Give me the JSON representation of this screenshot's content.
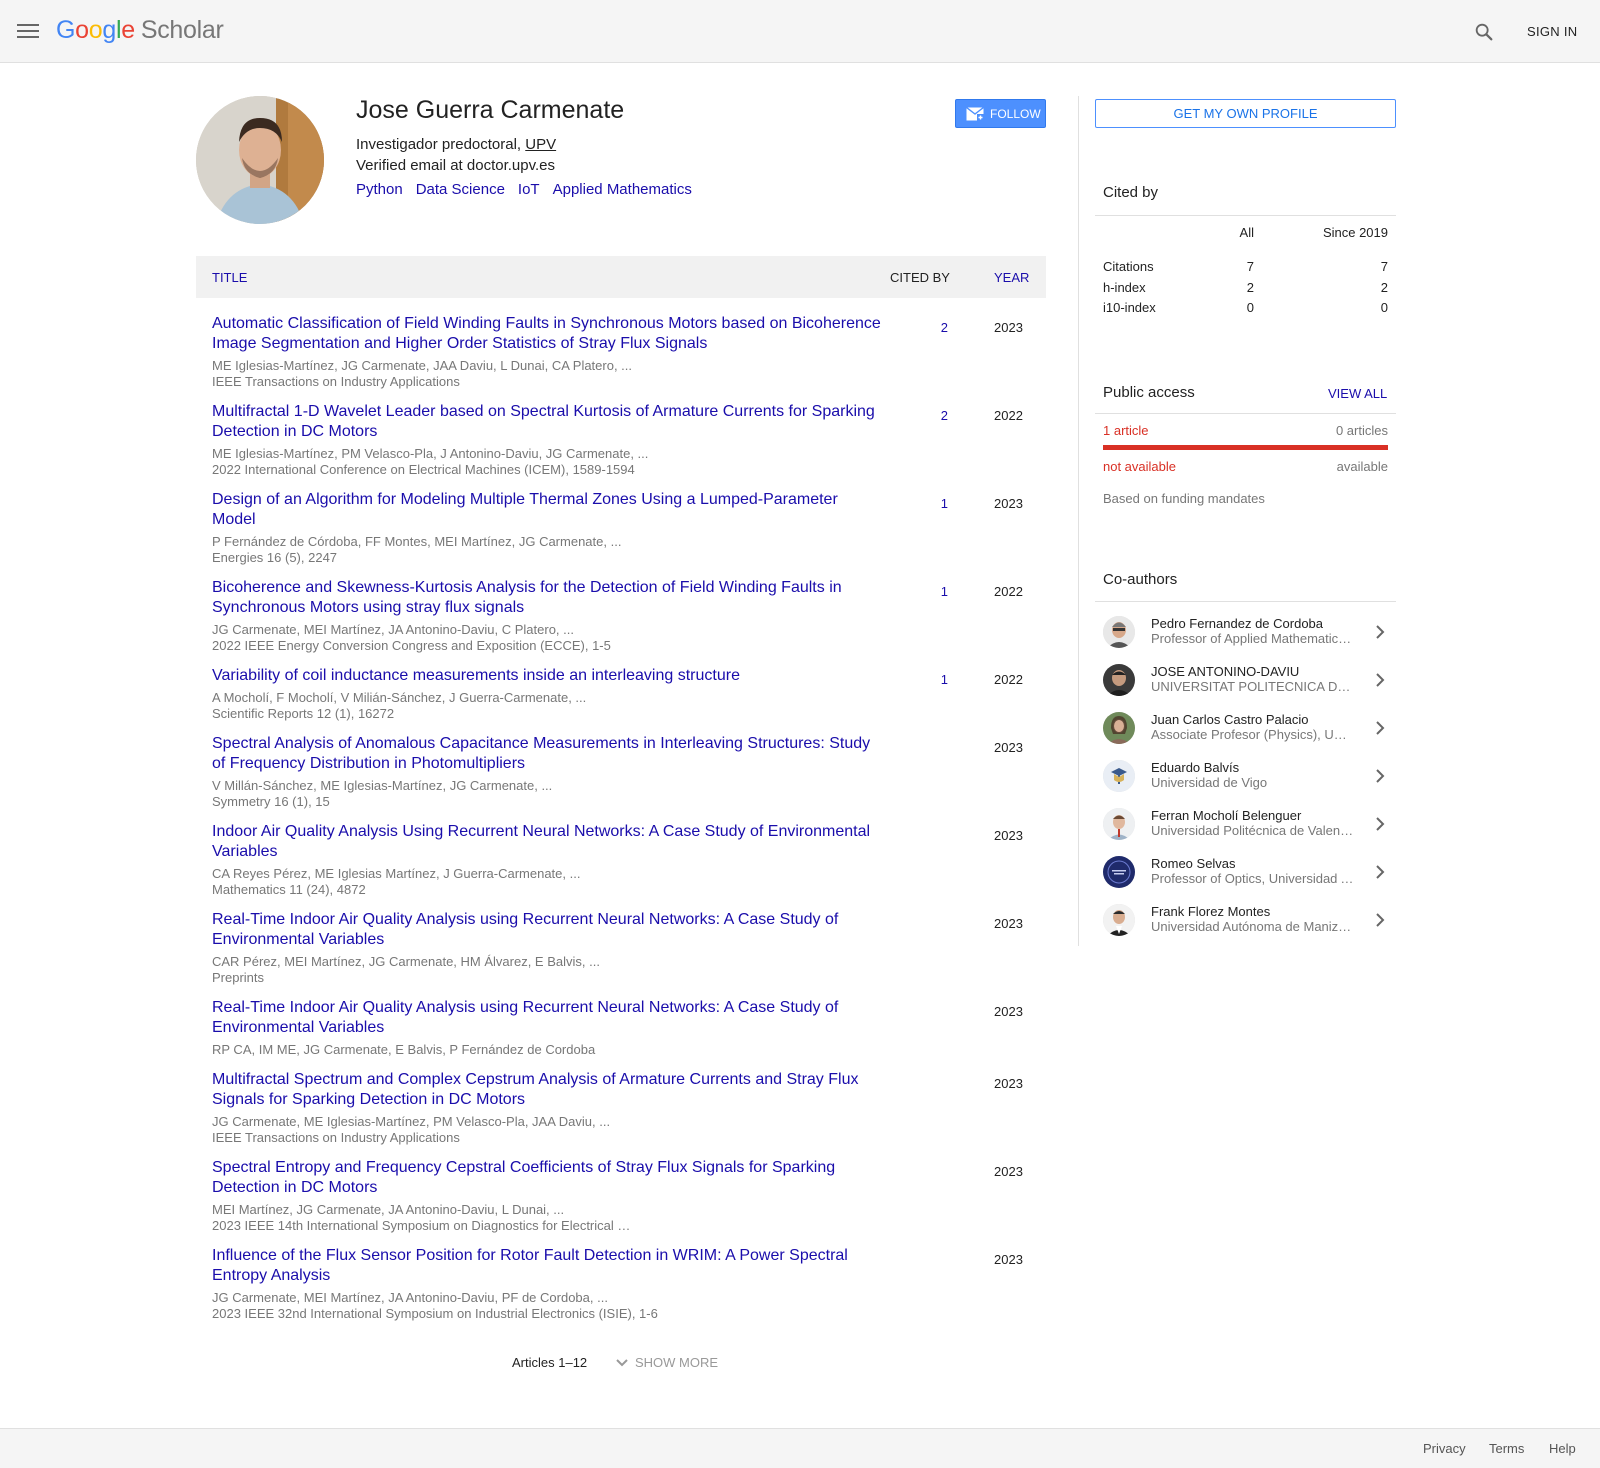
{
  "header": {
    "logo_google": [
      "G",
      "o",
      "o",
      "g",
      "l",
      "e"
    ],
    "logo_scholar": "Scholar",
    "signin_label": "SIGN IN"
  },
  "profile": {
    "name": "Jose Guerra Carmenate",
    "affiliation_prefix": "Investigador predoctoral, ",
    "affiliation_org": "UPV",
    "email": "Verified email at doctor.upv.es",
    "interests": [
      "Python",
      "Data Science",
      "IoT",
      "Applied Mathematics"
    ],
    "follow_label": "FOLLOW"
  },
  "table": {
    "col_title": "TITLE",
    "col_cited": "CITED BY",
    "col_year": "YEAR"
  },
  "articles": [
    {
      "title": "Automatic Classification of Field Winding Faults in Synchronous Motors based on Bicoherence Image Segmentation and Higher Order Statistics of Stray Flux Signals",
      "authors": "ME Iglesias-Martínez, JG Carmenate, JAA Daviu, L Dunai, CA Platero, ...",
      "venue": "IEEE Transactions on Industry Applications",
      "cited": "2",
      "year": "2023"
    },
    {
      "title": "Multifractal 1-D Wavelet Leader based on Spectral Kurtosis of Armature Currents for Sparking Detection in DC Motors",
      "authors": "ME Iglesias-Martínez, PM Velasco-Pla, J Antonino-Daviu, JG Carmenate, ...",
      "venue": "2022 International Conference on Electrical Machines (ICEM), 1589-1594",
      "cited": "2",
      "year": "2022"
    },
    {
      "title": "Design of an Algorithm for Modeling Multiple Thermal Zones Using a Lumped-Parameter Model",
      "authors": "P Fernández de Córdoba, FF Montes, MEI Martínez, JG Carmenate, ...",
      "venue": "Energies 16 (5), 2247",
      "cited": "1",
      "year": "2023"
    },
    {
      "title": "Bicoherence and Skewness-Kurtosis Analysis for the Detection of Field Winding Faults in Synchronous Motors using stray flux signals",
      "authors": "JG Carmenate, MEI Martínez, JA Antonino-Daviu, C Platero, ...",
      "venue": "2022 IEEE Energy Conversion Congress and Exposition (ECCE), 1-5",
      "cited": "1",
      "year": "2022"
    },
    {
      "title": "Variability of coil inductance measurements inside an interleaving structure",
      "authors": "A Mocholí, F Mocholí, V Milián-Sánchez, J Guerra-Carmenate, ...",
      "venue": "Scientific Reports 12 (1), 16272",
      "cited": "1",
      "year": "2022"
    },
    {
      "title": "Spectral Analysis of Anomalous Capacitance Measurements in Interleaving Structures: Study of Frequency Distribution in Photomultipliers",
      "authors": "V Millán-Sánchez, ME Iglesias-Martínez, JG Carmenate, ...",
      "venue": "Symmetry 16 (1), 15",
      "cited": "",
      "year": "2023"
    },
    {
      "title": "Indoor Air Quality Analysis Using Recurrent Neural Networks: A Case Study of Environmental Variables",
      "authors": "CA Reyes Pérez, ME Iglesias Martínez, J Guerra-Carmenate, ...",
      "venue": "Mathematics 11 (24), 4872",
      "cited": "",
      "year": "2023"
    },
    {
      "title": "Real-Time Indoor Air Quality Analysis using Recurrent Neural Networks: A Case Study of Environmental Variables",
      "authors": "CAR Pérez, MEI Martínez, JG Carmenate, HM Álvarez, E Balvis, ...",
      "venue": "Preprints",
      "cited": "",
      "year": "2023"
    },
    {
      "title": "Real-Time Indoor Air Quality Analysis using Recurrent Neural Networks: A Case Study of Environmental Variables",
      "authors": "RP CA, IM ME, JG Carmenate, E Balvis, P Fernández de Cordoba",
      "venue": "",
      "cited": "",
      "year": "2023"
    },
    {
      "title": "Multifractal Spectrum and Complex Cepstrum Analysis of Armature Currents and Stray Flux Signals for Sparking Detection in DC Motors",
      "authors": "JG Carmenate, ME Iglesias-Martínez, PM Velasco-Pla, JAA Daviu, ...",
      "venue": "IEEE Transactions on Industry Applications",
      "cited": "",
      "year": "2023"
    },
    {
      "title": "Spectral Entropy and Frequency Cepstral Coefficients of Stray Flux Signals for Sparking Detection in DC Motors",
      "authors": "MEI Martínez, JG Carmenate, JA Antonino-Daviu, L Dunai, ...",
      "venue": "2023 IEEE 14th International Symposium on Diagnostics for Electrical …",
      "cited": "",
      "year": "2023"
    },
    {
      "title": "Influence of the Flux Sensor Position for Rotor Fault Detection in WRIM: A Power Spectral Entropy Analysis",
      "authors": "JG Carmenate, MEI Martínez, JA Antonino-Daviu, PF de Cordoba, ...",
      "venue": "2023 IEEE 32nd International Symposium on Industrial Electronics (ISIE), 1-6",
      "cited": "",
      "year": "2023"
    }
  ],
  "pager": {
    "range": "Articles 1–12",
    "show_more": "SHOW MORE"
  },
  "sidebar": {
    "get_profile": "GET MY OWN PROFILE",
    "cited_by": {
      "title": "Cited by",
      "col_all": "All",
      "col_since": "Since 2019",
      "rows": [
        {
          "label": "Citations",
          "all": "7",
          "since": "7"
        },
        {
          "label": "h-index",
          "all": "2",
          "since": "2"
        },
        {
          "label": "i10-index",
          "all": "0",
          "since": "0"
        }
      ]
    },
    "public_access": {
      "title": "Public access",
      "view_all": "VIEW ALL",
      "left_count": "1 article",
      "right_count": "0 articles",
      "left_status": "not available",
      "right_status": "available",
      "note": "Based on funding mandates"
    },
    "coauthors": {
      "title": "Co-authors",
      "items": [
        {
          "name": "Pedro Fernandez de Cordoba",
          "affiliation": "Professor of Applied Mathematics, Universitat Politècnica de València"
        },
        {
          "name": "JOSE ANTONINO-DAVIU",
          "affiliation": "UNIVERSITAT POLITECNICA DE VALENCIA"
        },
        {
          "name": "Juan Carlos Castro Palacio",
          "affiliation": "Associate Profesor (Physics), Universitat Politècnica de València"
        },
        {
          "name": "Eduardo Balvís",
          "affiliation": "Universidad de Vigo"
        },
        {
          "name": "Ferran Mocholí Belenguer",
          "affiliation": "Universidad Politécnica de Valencia"
        },
        {
          "name": "Romeo Selvas",
          "affiliation": "Professor of Optics, Universidad Autónoma de Nuevo León"
        },
        {
          "name": "Frank Florez Montes",
          "affiliation": "Universidad Autónoma de Manizales"
        }
      ]
    }
  },
  "footer": {
    "privacy": "Privacy",
    "terms": "Terms",
    "help": "Help"
  },
  "colors": {
    "link": "#1a0dab",
    "accent": "#4d90fe",
    "unavailable": "#d93025"
  }
}
